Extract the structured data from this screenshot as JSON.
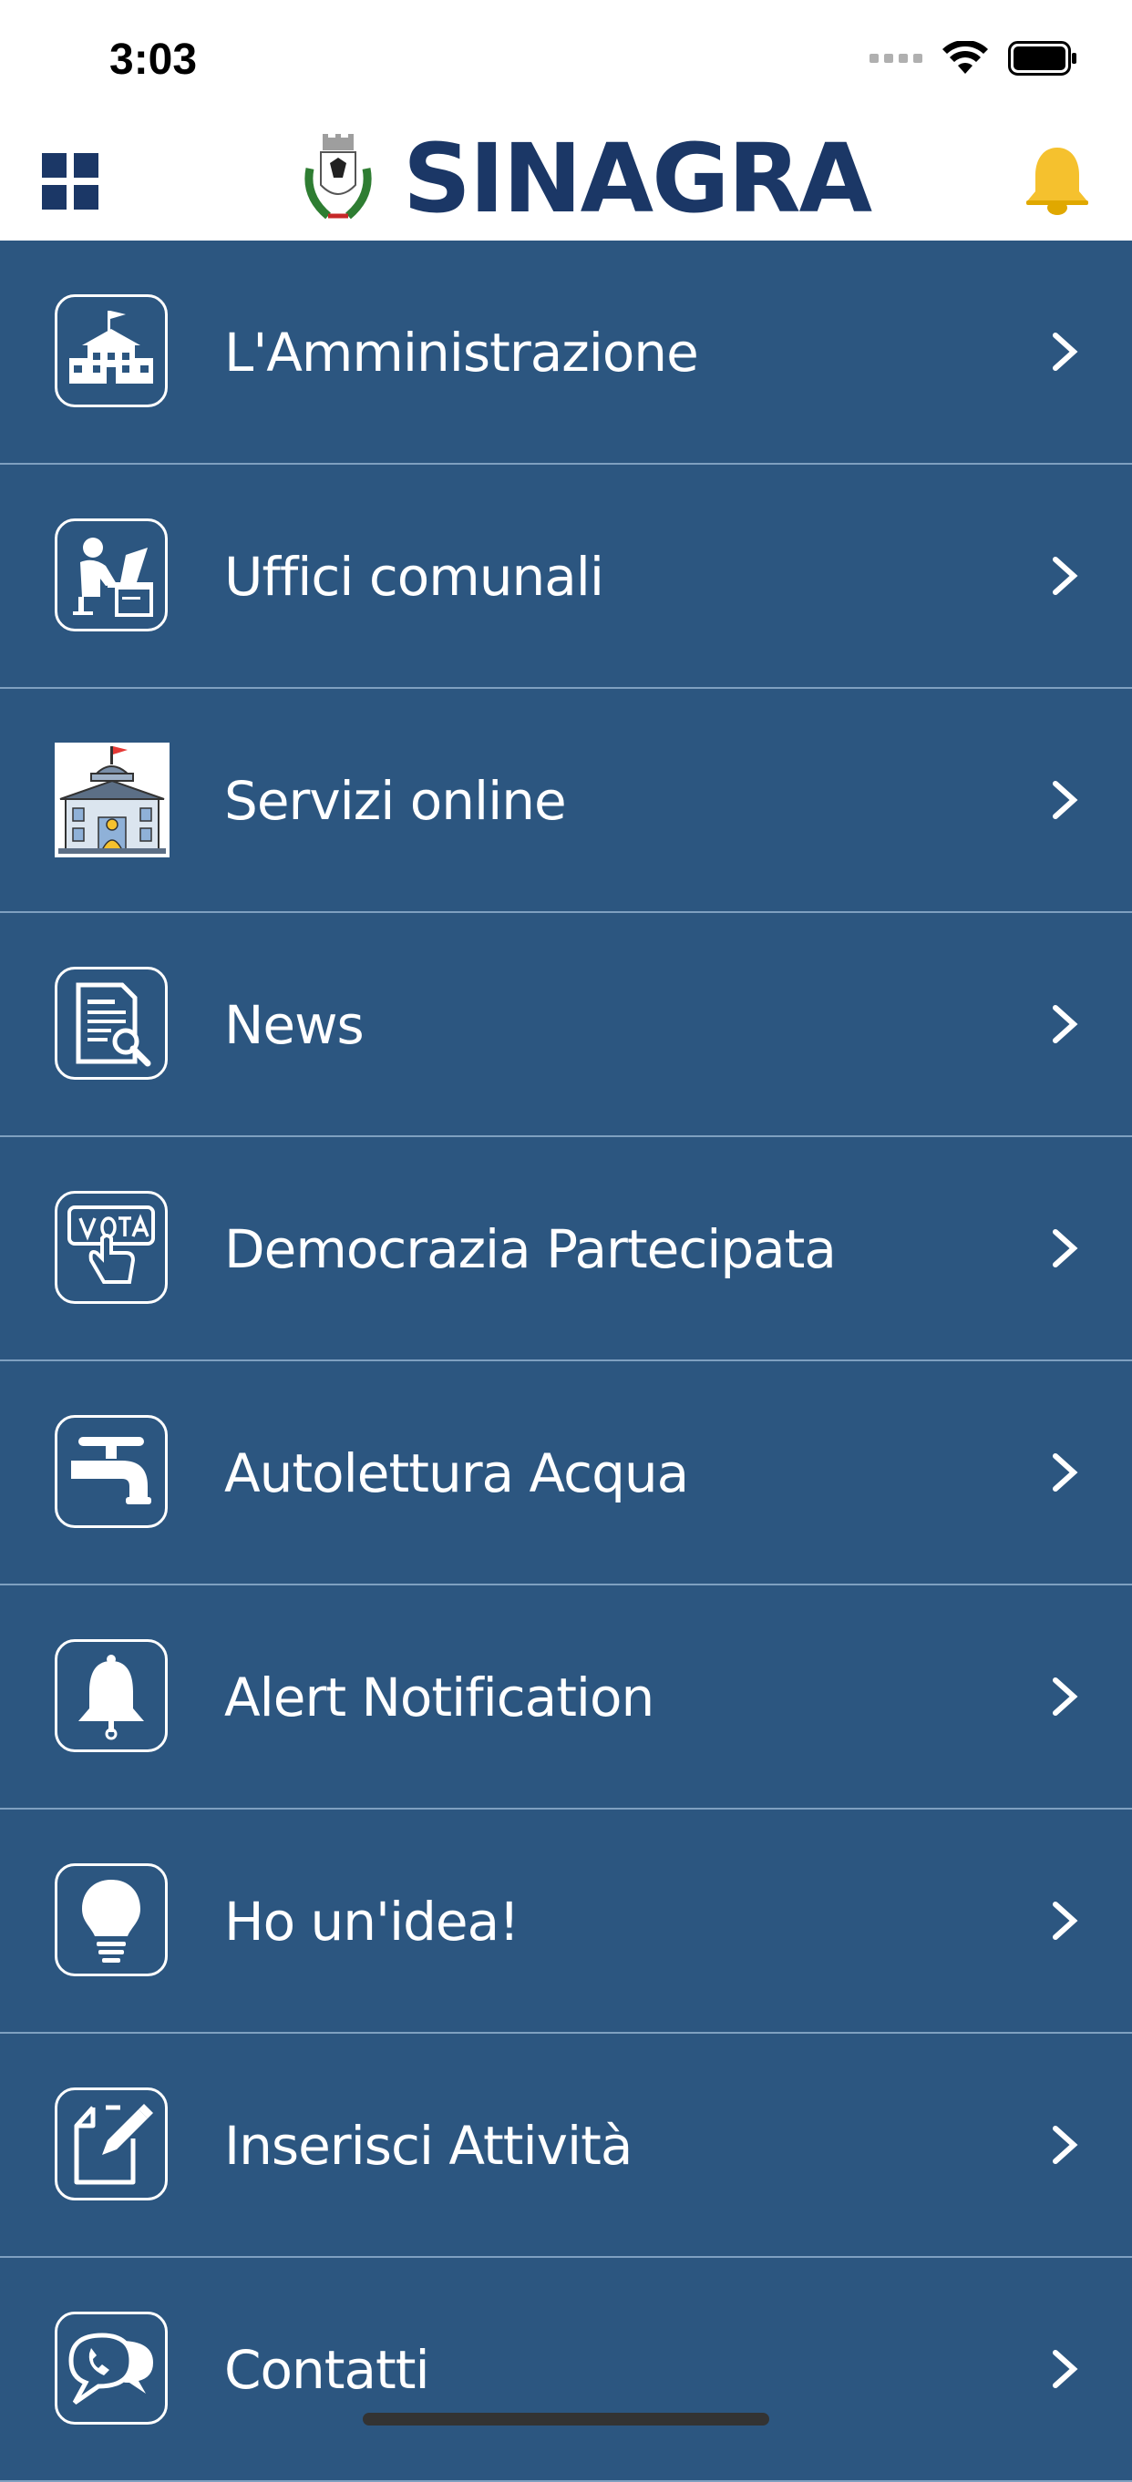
{
  "status_bar": {
    "time": "3:03"
  },
  "header": {
    "title": "SINAGRA"
  },
  "colors": {
    "background": "#2c5680",
    "title": "#1b3766",
    "bell": "#f5c12e",
    "divider": "#7fa0c0"
  },
  "menu": [
    {
      "label": "L'Amministrazione",
      "icon": "town-hall-icon"
    },
    {
      "label": "Uffici comunali",
      "icon": "office-worker-icon"
    },
    {
      "label": "Servizi online",
      "icon": "municipal-building-icon"
    },
    {
      "label": "News",
      "icon": "document-search-icon"
    },
    {
      "label": "Democrazia Partecipata",
      "icon": "vote-hand-icon"
    },
    {
      "label": "Autolettura Acqua",
      "icon": "water-tap-icon"
    },
    {
      "label": "Alert Notification",
      "icon": "bell-icon"
    },
    {
      "label": "Ho un'idea!",
      "icon": "lightbulb-icon"
    },
    {
      "label": "Inserisci Attività",
      "icon": "edit-document-icon"
    },
    {
      "label": "Contatti",
      "icon": "chat-phone-icon"
    }
  ]
}
